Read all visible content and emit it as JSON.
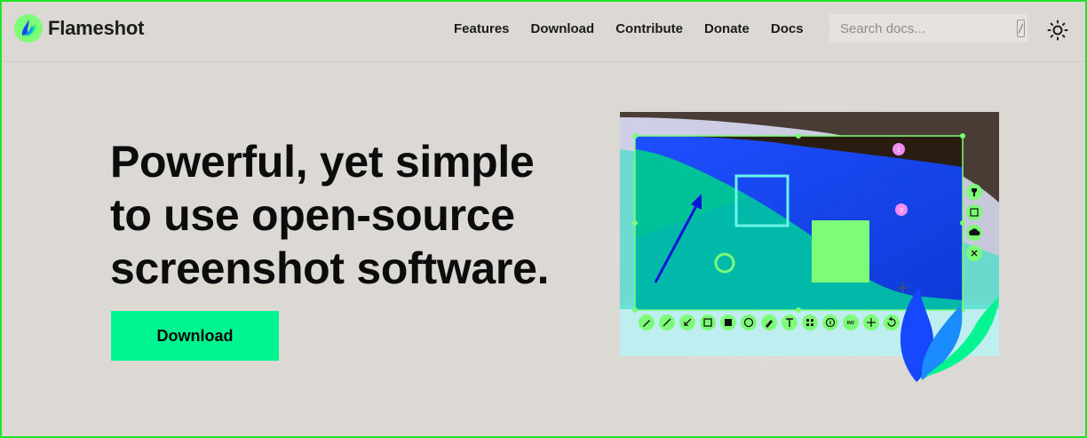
{
  "brand": {
    "name": "Flameshot",
    "logo_icon": "flameshot-logo-icon"
  },
  "nav": {
    "links": [
      {
        "label": "Features"
      },
      {
        "label": "Download"
      },
      {
        "label": "Contribute"
      },
      {
        "label": "Donate"
      },
      {
        "label": "Docs"
      }
    ]
  },
  "search": {
    "placeholder": "Search docs...",
    "shortcut_key": "/"
  },
  "theme_toggle": {
    "icon": "sun-icon"
  },
  "hero": {
    "title_lines": [
      "Powerful, yet simple",
      "to use open-source",
      "screenshot software."
    ],
    "download_label": "Download"
  },
  "illustration": {
    "selection_badges": [
      "1",
      "2"
    ],
    "toolbar_icons": [
      "pencil-icon",
      "line-icon",
      "arrow-icon",
      "rectangle-icon",
      "filled-rectangle-icon",
      "circle-icon",
      "marker-icon",
      "text-icon",
      "pixelate-icon",
      "counter-icon",
      "invert-icon",
      "move-icon",
      "undo-icon",
      "redo-icon"
    ],
    "side_icons": [
      "pin-icon",
      "app-launcher-icon",
      "upload-icon",
      "close-icon"
    ],
    "invert_label": "INV"
  },
  "colors": {
    "accent": "#00f591",
    "frame": "#22e22a",
    "background": "#dcd9d4",
    "selection_green": "#7cfc77",
    "marker_pink": "#f28cf5"
  }
}
